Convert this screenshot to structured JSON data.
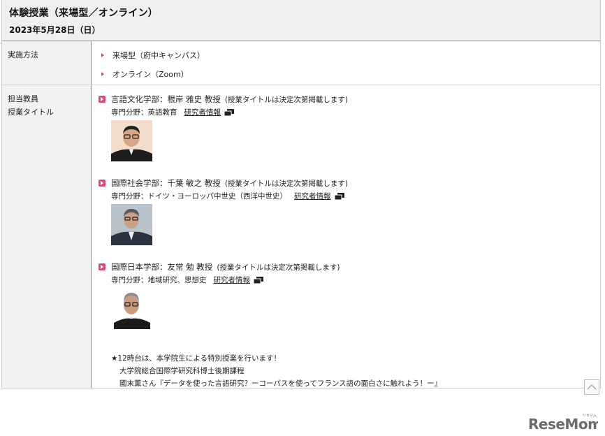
{
  "header": {
    "title": "体験授業（来場型／オンライン）",
    "date": "2023年5月28日（日）"
  },
  "method": {
    "label": "実施方法",
    "items": [
      "来場型（府中キャンパス）",
      "オンライン（Zoom）"
    ]
  },
  "teachers_section": {
    "label_line1": "担当教員",
    "label_line2": "授業タイトル",
    "teachers": [
      {
        "name": "言語文化学部：根岸 雅史 教授",
        "note": "(授業タイトルは決定次第掲載します)",
        "field": "専門分野：英語教育",
        "link": "研究者情報"
      },
      {
        "name": "国際社会学部：千葉 敏之 教授",
        "note": "(授業タイトルは決定次第掲載します)",
        "field": "専門分野：ドイツ・ヨーロッパ中世史（西洋中世史）",
        "link": "研究者情報"
      },
      {
        "name": "国際日本学部：友常 勉 教授",
        "note": "(授業タイトルは決定次第掲載します)",
        "field": "専門分野：地域研究、思想史",
        "link": "研究者情報"
      }
    ],
    "special": {
      "line1": "★12時台は、本学院生による特別授業を行います！",
      "line2": "大学院総合国際学研究科博士後期課程",
      "line3": "國末薫さん『データを使った言語研究？ーコーパスを使ってフランス語の面白さに触れよう！ー』"
    }
  },
  "logo": {
    "text": "ReseMom",
    "small": "リセマム"
  },
  "colors": {
    "accent": "#e0457b",
    "header_bg": "#efefef",
    "label_bg": "#f2f2f2"
  }
}
